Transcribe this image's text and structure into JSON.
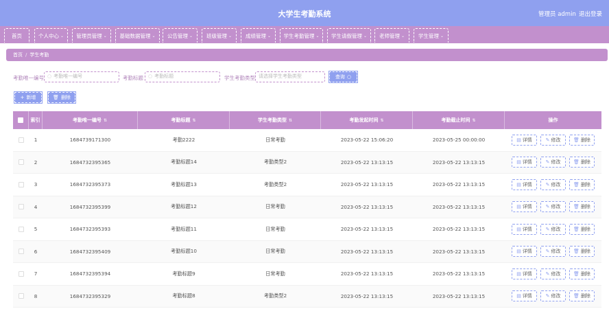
{
  "header": {
    "title": "大学生考勤系统",
    "user": "管理员 admin",
    "logout": "退出登录"
  },
  "nav": [
    {
      "label": "首页",
      "chevron": false
    },
    {
      "label": "个人中心",
      "chevron": true
    },
    {
      "label": "管理员管理",
      "chevron": true
    },
    {
      "label": "基础数据管理",
      "chevron": true
    },
    {
      "label": "公告管理",
      "chevron": true
    },
    {
      "label": "班级管理",
      "chevron": true
    },
    {
      "label": "成绩管理",
      "chevron": true
    },
    {
      "label": "学生考勤管理",
      "chevron": true
    },
    {
      "label": "学生请假管理",
      "chevron": true
    },
    {
      "label": "老师管理",
      "chevron": true
    },
    {
      "label": "学生管理",
      "chevron": true
    }
  ],
  "breadcrumb": {
    "home": "首页",
    "current": "学生考勤"
  },
  "filters": {
    "id_label": "考勤唯一编号",
    "id_placeholder": "考勤唯一编号",
    "title_label": "考勤标题",
    "title_placeholder": "考勤标题",
    "type_label": "学生考勤类型",
    "type_placeholder": "请选择学生考勤类型",
    "search_button": "查询"
  },
  "actions": {
    "add": "新增",
    "delete": "删除"
  },
  "table": {
    "columns": [
      "索引",
      "考勤唯一编号",
      "考勤标题",
      "学生考勤类型",
      "考勤发起时间",
      "考勤截止时间",
      "操作"
    ],
    "row_actions": {
      "detail": "详情",
      "edit": "修改",
      "delete": "删除"
    },
    "rows": [
      {
        "index": "1",
        "id": "1684739171300",
        "title": "考勤2222",
        "type": "日常考勤",
        "start": "2023-05-22 15:06:20",
        "end": "2023-05-25 00:00:00"
      },
      {
        "index": "2",
        "id": "1684732395365",
        "title": "考勤标题14",
        "type": "考勤类型2",
        "start": "2023-05-22 13:13:15",
        "end": "2023-05-22 13:13:15"
      },
      {
        "index": "3",
        "id": "1684732395373",
        "title": "考勤标题13",
        "type": "考勤类型2",
        "start": "2023-05-22 13:13:15",
        "end": "2023-05-22 13:13:15"
      },
      {
        "index": "4",
        "id": "1684732395399",
        "title": "考勤标题12",
        "type": "日常考勤",
        "start": "2023-05-22 13:13:15",
        "end": "2023-05-22 13:13:15"
      },
      {
        "index": "5",
        "id": "1684732395393",
        "title": "考勤标题11",
        "type": "日常考勤",
        "start": "2023-05-22 13:13:15",
        "end": "2023-05-22 13:13:15"
      },
      {
        "index": "6",
        "id": "1684732395409",
        "title": "考勤标题10",
        "type": "日常考勤",
        "start": "2023-05-22 13:13:15",
        "end": "2023-05-22 13:13:15"
      },
      {
        "index": "7",
        "id": "1684732395394",
        "title": "考勤标题9",
        "type": "日常考勤",
        "start": "2023-05-22 13:13:15",
        "end": "2023-05-22 13:13:15"
      },
      {
        "index": "8",
        "id": "1684732395329",
        "title": "考勤标题8",
        "type": "考勤类型2",
        "start": "2023-05-22 13:13:15",
        "end": "2023-05-22 13:13:15"
      }
    ]
  },
  "colors": {
    "header": "#8fa0ef",
    "nav": "#c290cd",
    "accent": "#8fa0ef"
  }
}
